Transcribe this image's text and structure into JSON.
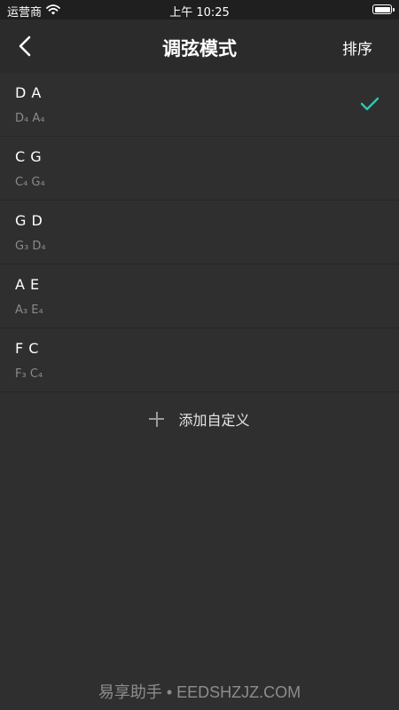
{
  "status_bar": {
    "carrier": "运营商",
    "time": "上午 10:25"
  },
  "nav": {
    "title": "调弦模式",
    "sort_label": "排序"
  },
  "tunings": [
    {
      "name": "D A",
      "notes": "D₄  A₄",
      "selected": true
    },
    {
      "name": "C G",
      "notes": "C₄  G₄",
      "selected": false
    },
    {
      "name": "G D",
      "notes": "G₃  D₄",
      "selected": false
    },
    {
      "name": "A E",
      "notes": "A₃  E₄",
      "selected": false
    },
    {
      "name": "F C",
      "notes": "F₃  C₄",
      "selected": false
    }
  ],
  "add_custom_label": "添加自定义",
  "watermark": "易享助手 • EEDSHZJZ.COM",
  "colors": {
    "background": "#2f2f2f",
    "accent_check": "#2cc7b0"
  }
}
